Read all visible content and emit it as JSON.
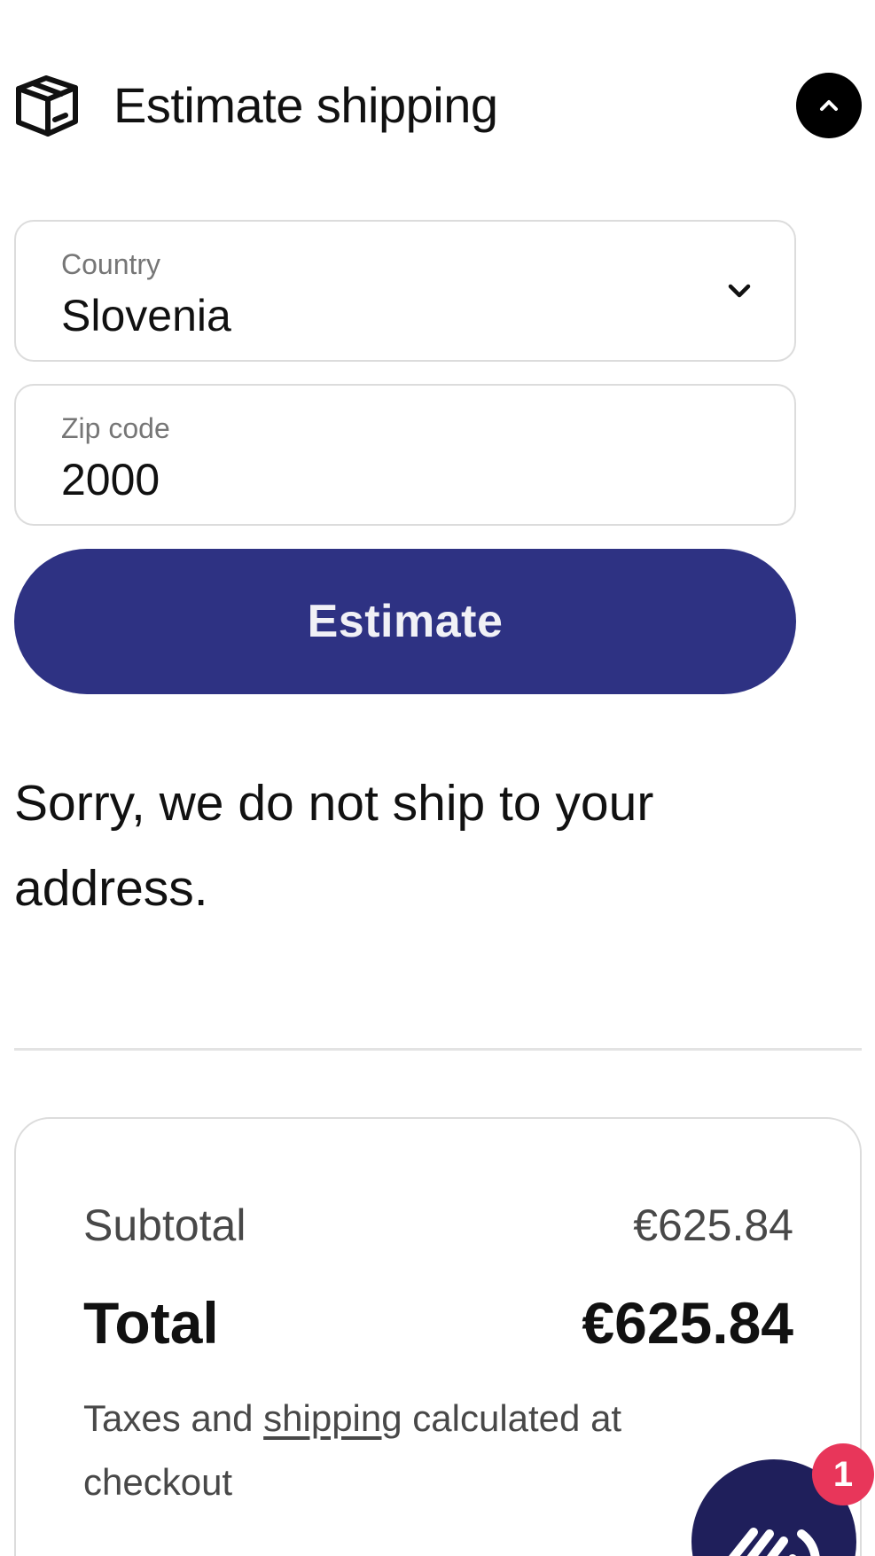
{
  "header": {
    "title": "Estimate shipping",
    "icon": "package-icon",
    "toggle_icon": "chevron-up-icon"
  },
  "form": {
    "country": {
      "label": "Country",
      "value": "Slovenia",
      "icon": "chevron-down-icon"
    },
    "zip": {
      "label": "Zip code",
      "value": "2000"
    },
    "estimate_label": "Estimate"
  },
  "result": {
    "message": "Sorry, we do not ship to your address."
  },
  "totals": {
    "subtotal_label": "Subtotal",
    "subtotal_value": "€625.84",
    "total_label": "Total",
    "total_value": "€625.84",
    "note_before": "Taxes and ",
    "note_link": "shipping",
    "note_after": " calculated at checkout"
  },
  "chat": {
    "icon": "waving-hand-icon",
    "badge_count": "1"
  },
  "colors": {
    "primary": "#2e3283",
    "chat_bg": "#1f1f5b",
    "badge": "#e8365a",
    "border": "#dcdcdc"
  }
}
